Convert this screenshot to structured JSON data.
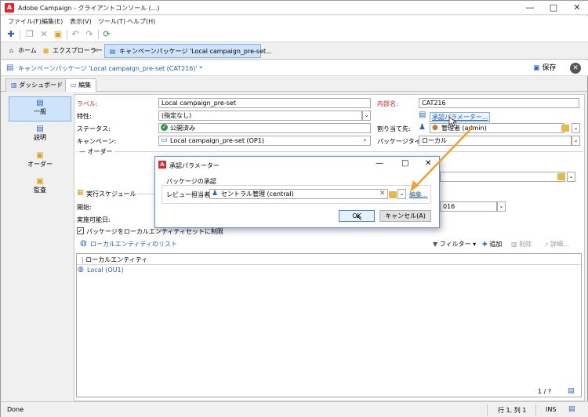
{
  "window": {
    "title": "Adobe Campaign - クライアントコンソール (...)",
    "logo_letter": "A"
  },
  "menu": [
    "ファイル(F)",
    "編集(E)",
    "表示(V)",
    "ツール(T)",
    "ヘルプ(H)"
  ],
  "tabs": {
    "home": "ホーム",
    "explorer": "エクスプローラー",
    "document": "キャンペーンパッケージ 'Local campaign_pre-set...",
    "close": "✕"
  },
  "doc": {
    "title": "キャンペーンパッケージ 'Local campaign_pre-set (CAT216)' *",
    "save": "保存"
  },
  "subtabs": {
    "dashboard": "ダッシュボード",
    "edit": "編集"
  },
  "nav": [
    "一般",
    "説明",
    "オーダー",
    "監査"
  ],
  "form": {
    "label_lbl": "ラベル:",
    "label_val": "Local campaign_pre-set",
    "internal_lbl": "内部名:",
    "internal_val": "CAT216",
    "nature_lbl": "特性:",
    "nature_val": "(指定なし)",
    "approval_link": "承認パラメーター...",
    "status_lbl": "ステータス:",
    "status_val": "公開済み",
    "assign_lbl": "割り当て先:",
    "assign_val": "管理者 (admin)",
    "campaign_lbl": "キャンペーン:",
    "campaign_val": "Local campaign_pre-set (OP1)",
    "pkgtype_lbl": "パッケージタイプ:",
    "pkgtype_val": "ローカル",
    "order_section": "オーダー",
    "schedule_section": "実行スケジュール",
    "start_lbl": "開始:",
    "start_val": "016",
    "avail_lbl": "実施可能日:",
    "checkbox_lbl": "パッケージをローカルエンティティセットに制限"
  },
  "list": {
    "link": "ローカルエンティティのリスト",
    "filter": "フィルター",
    "add": "追加",
    "delete": "削除",
    "detail": "詳細...",
    "header": "ローカルエンティティ",
    "rows": [
      "Local (OU1)"
    ],
    "pager": "1 / ?"
  },
  "status": {
    "left": "Done",
    "pos": "行 1, 列 1",
    "ins": "INS"
  },
  "dialog": {
    "title": "承認パラメーター",
    "group": "パッケージの承認",
    "reviewer_lbl": "レビュー担当者:",
    "reviewer_val": "セントラル管理 (central)",
    "edit_link": "編集...",
    "ok": "OK",
    "cancel": "キャンセル(A)"
  },
  "colors": {
    "accent": "#1f5fa8",
    "arrow": "#f0a030",
    "brand": "#e3262d"
  }
}
